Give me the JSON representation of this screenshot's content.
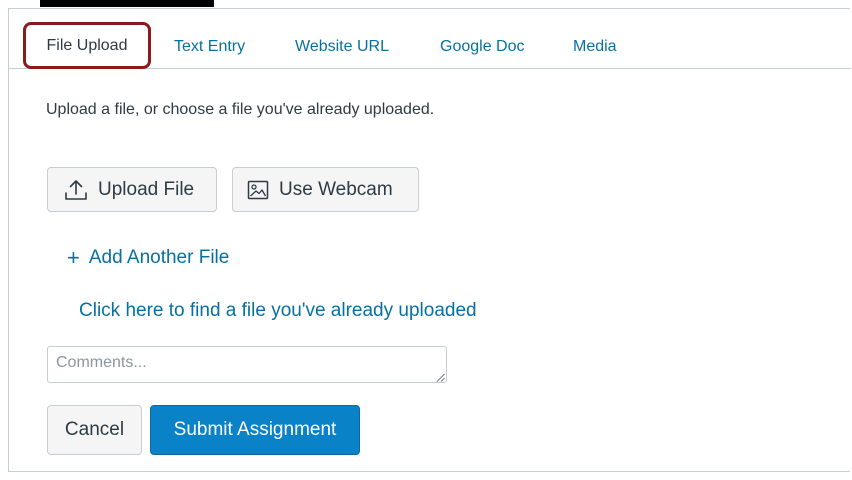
{
  "tabs": [
    {
      "label": "File Upload",
      "active": true
    },
    {
      "label": "Text Entry",
      "active": false
    },
    {
      "label": "Website URL",
      "active": false
    },
    {
      "label": "Google Doc",
      "active": false
    },
    {
      "label": "Media",
      "active": false
    }
  ],
  "intro_text": "Upload a file, or choose a file you've already uploaded.",
  "buttons": {
    "upload_file": "Upload File",
    "use_webcam": "Use Webcam",
    "cancel": "Cancel",
    "submit": "Submit Assignment"
  },
  "links": {
    "add_another_file": "Add Another File",
    "add_icon_glyph": "+",
    "find_uploaded": "Click here to find a file you've already uploaded"
  },
  "comments": {
    "placeholder": "Comments...",
    "value": ""
  },
  "icons": {
    "upload": "upload-icon",
    "webcam": "image-icon",
    "add": "plus-icon"
  },
  "colors": {
    "link": "#0770a3",
    "text": "#2d3b45",
    "primary_button": "#0a82c8",
    "highlight_outline": "#8b1a1f",
    "border": "#c7cdd1"
  }
}
